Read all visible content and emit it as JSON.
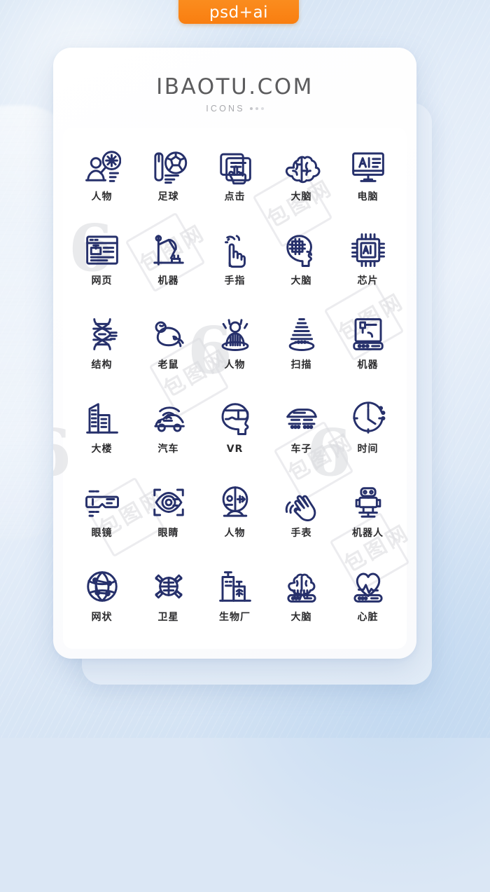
{
  "badge": {
    "label": "psd+ai",
    "color": "#f7871f"
  },
  "card": {
    "brand": "IBAOTU.COM",
    "subtitle": "ICONS",
    "icon_color": "#26306b",
    "label_color": "#2b2b2d"
  },
  "watermark": {
    "text": "包图网",
    "mark": "6"
  },
  "icons": [
    {
      "name": "person-search-icon",
      "label": "人物"
    },
    {
      "name": "football-analysis-icon",
      "label": "足球"
    },
    {
      "name": "click-touch-icon",
      "label": "点击"
    },
    {
      "name": "brain-icon",
      "label": "大脑"
    },
    {
      "name": "ai-monitor-icon",
      "label": "电脑"
    },
    {
      "name": "webpage-icon",
      "label": "网页"
    },
    {
      "name": "robotic-arm-icon",
      "label": "机器"
    },
    {
      "name": "finger-point-icon",
      "label": "手指"
    },
    {
      "name": "head-circuit-icon",
      "label": "大脑"
    },
    {
      "name": "ai-chip-icon",
      "label": "芯片"
    },
    {
      "name": "dna-structure-icon",
      "label": "结构"
    },
    {
      "name": "lab-mouse-icon",
      "label": "老鼠"
    },
    {
      "name": "hologram-person-icon",
      "label": "人物"
    },
    {
      "name": "scan-beam-icon",
      "label": "扫描"
    },
    {
      "name": "machine-printer-icon",
      "label": "机器"
    },
    {
      "name": "buildings-icon",
      "label": "大楼"
    },
    {
      "name": "smart-car-icon",
      "label": "汽车"
    },
    {
      "name": "vr-headset-icon",
      "label": "VR"
    },
    {
      "name": "hover-car-icon",
      "label": "车子"
    },
    {
      "name": "clock-time-icon",
      "label": "时间"
    },
    {
      "name": "smart-glasses-icon",
      "label": "眼镜"
    },
    {
      "name": "eye-scan-icon",
      "label": "眼睛"
    },
    {
      "name": "android-face-icon",
      "label": "人物"
    },
    {
      "name": "gesture-hand-icon",
      "label": "手表"
    },
    {
      "name": "robot-icon",
      "label": "机器人"
    },
    {
      "name": "globe-network-icon",
      "label": "网状"
    },
    {
      "name": "satellite-icon",
      "label": "卫星"
    },
    {
      "name": "bio-factory-icon",
      "label": "生物厂"
    },
    {
      "name": "brain-chip-icon",
      "label": "大脑"
    },
    {
      "name": "heart-chip-icon",
      "label": "心脏"
    }
  ]
}
